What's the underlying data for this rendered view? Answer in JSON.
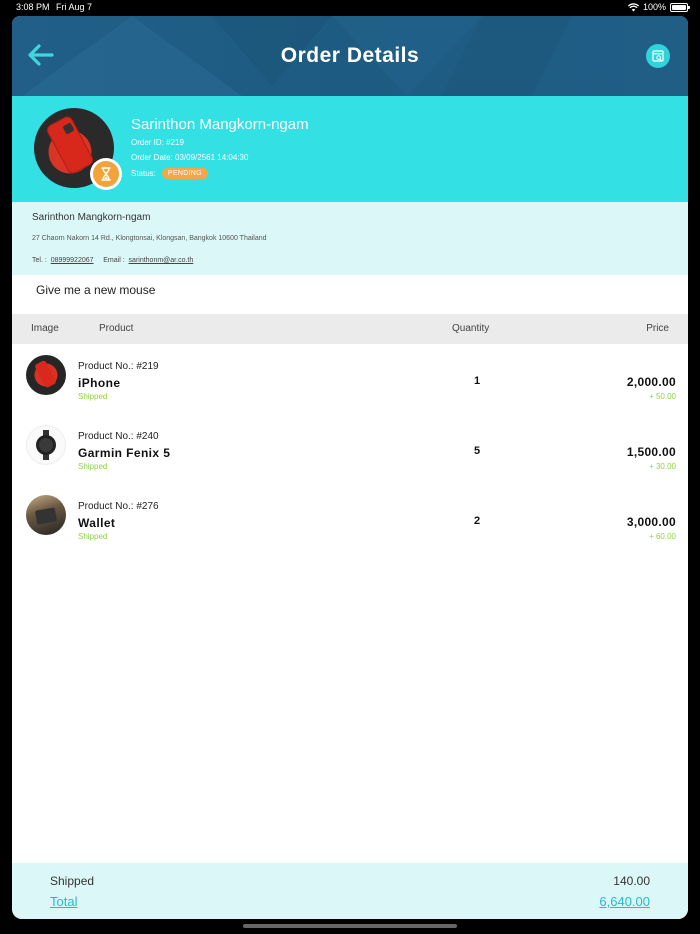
{
  "status_bar": {
    "time": "3:08 PM",
    "date": "Fri Aug 7",
    "battery": "100%"
  },
  "header": {
    "title": "Order Details",
    "back_icon": "back-arrow-icon",
    "action_icon": "document-search-icon"
  },
  "summary": {
    "customer_name": "Sarinthon Mangkorn-ngam",
    "order_id": "Order ID: #219",
    "order_date": "Order Date: 03/09/2561 14:04:30",
    "status_label": "Status:",
    "status_value": "PENDING"
  },
  "address": {
    "name": "Sarinthon Mangkorn-ngam",
    "line": "27 Chaorn Nakorn 14 Rd., Klongtonsai, Klongsan, Bangkok 10600 Thailand",
    "tel_label": "Tel. :",
    "tel": "08999922067",
    "email_label": "Email :",
    "email": "sarinthonm@ar.co.th"
  },
  "note": "Give me a new mouse",
  "table": {
    "headers": {
      "image": "Image",
      "product": "Product",
      "quantity": "Quantity",
      "price": "Price"
    },
    "rows": [
      {
        "product_no": "Product No.: #219",
        "name": "iPhone",
        "status": "Shipped",
        "quantity": "1",
        "price": "2,000.00",
        "extra": "+ 50.00"
      },
      {
        "product_no": "Product No.: #240",
        "name": "Garmin Fenix 5",
        "status": "Shipped",
        "quantity": "5",
        "price": "1,500.00",
        "extra": "+ 30.00"
      },
      {
        "product_no": "Product No.: #276",
        "name": "Wallet",
        "status": "Shipped",
        "quantity": "2",
        "price": "3,000.00",
        "extra": "+ 60.00"
      }
    ]
  },
  "footer": {
    "shipped_label": "Shipped",
    "shipped_value": "140.00",
    "total_label": "Total",
    "total_value": "6,640.00"
  },
  "colors": {
    "header": "#1e5b82",
    "accent": "#33e0e3",
    "light": "#dcf7f8",
    "pending": "#f6a648",
    "shipped": "#8fd24a",
    "total": "#1fbec9"
  }
}
